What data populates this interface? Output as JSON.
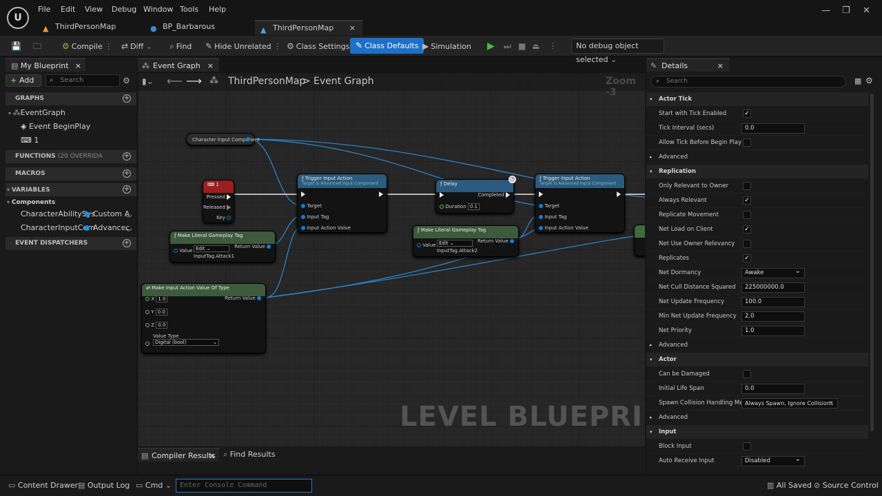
{
  "menu": [
    "File",
    "Edit",
    "View",
    "Debug",
    "Window",
    "Tools",
    "Help"
  ],
  "tabs": [
    {
      "label": "ThirdPersonMap"
    },
    {
      "label": "BP_Barbarous"
    },
    {
      "label": "ThirdPersonMap"
    }
  ],
  "tab_close": "×",
  "toolbar": {
    "compile": "Compile",
    "diff": "Diff",
    "find": "Find",
    "hide_unrelated": "Hide Unrelated",
    "class_settings": "Class Settings",
    "class_defaults": "Class Defaults",
    "simulation": "Simulation",
    "debug_object": "No debug object selected"
  },
  "my_blueprint": {
    "title": "My Blueprint",
    "add": "Add",
    "search_placeholder": "Search",
    "graphs": "GRAPHS",
    "event_graph": "EventGraph",
    "begin_play": "Event BeginPlay",
    "item_1": "1",
    "functions": "FUNCTIONS",
    "functions_count": "(20 OVERRIDA",
    "macros": "MACROS",
    "variables": "VARIABLES",
    "components": "Components",
    "comp1_name": "CharacterAbilitySys",
    "comp1_type": "Custom A",
    "comp2_name": "CharacterInputCom",
    "comp2_type": "Advancec",
    "event_dispatchers": "EVENT DISPATCHERS"
  },
  "graph": {
    "tab": "Event Graph",
    "crumb_root": "ThirdPersonMap",
    "crumb_sep": ">",
    "crumb_leaf": "Event Graph",
    "zoom": "Zoom -3",
    "watermark": "LEVEL BLUEPRINT",
    "nodes": {
      "char_input": "Character Input Component",
      "key_title": "1",
      "pressed": "Pressed",
      "released": "Released",
      "key": "Key",
      "trigger_title": "Trigger Input Action",
      "trigger_sub": "Target is Advanced Input Component",
      "target": "Target",
      "input_tag": "Input Tag",
      "input_action_value": "Input Action Value",
      "delay_title": "Delay",
      "completed": "Completed",
      "duration": "Duration",
      "duration_val": "0.1",
      "tag1_title": "Make Literal Gameplay Tag",
      "value": "Value",
      "edit": "Edit",
      "return_value": "Return Value",
      "tag1_val": "InputTag.Attack1",
      "tag2_val": "InputTag.Attack2",
      "miav_title": "Make Input Action Value Of Type",
      "x": "X",
      "y": "Y",
      "z": "Z",
      "x_val": "1.0",
      "y_val": "0.0",
      "z_val": "0.0",
      "value_type": "Value Type",
      "value_type_val": "Digital (bool)"
    }
  },
  "bottom_tabs": {
    "compiler_results": "Compiler Results",
    "find_results": "Find Results"
  },
  "details": {
    "title": "Details",
    "search_placeholder": "Search",
    "actor_tick": "Actor Tick",
    "start_tick": "Start with Tick Enabled",
    "tick_interval": "Tick Interval (secs)",
    "tick_interval_val": "0.0",
    "allow_tick": "Allow Tick Before Begin Play",
    "advanced": "Advanced",
    "replication": "Replication",
    "only_relevant": "Only Relevant to Owner",
    "always_relevant": "Always Relevant",
    "replicate_movement": "Replicate Movement",
    "net_load": "Net Load on Client",
    "net_use_owner": "Net Use Owner Relevancy",
    "replicates": "Replicates",
    "net_dormancy": "Net Dormancy",
    "net_dormancy_val": "Awake",
    "net_cull": "Net Cull Distance Squared",
    "net_cull_val": "225000000.0",
    "net_update": "Net Update Frequency",
    "net_update_val": "100.0",
    "min_net_update": "Min Net Update Frequency",
    "min_net_update_val": "2.0",
    "net_priority": "Net Priority",
    "net_priority_val": "1.0",
    "actor": "Actor",
    "can_be_damaged": "Can be Damaged",
    "life_span": "Initial Life Span",
    "life_span_val": "0.0",
    "spawn_coll": "Spawn Collision Handling Me...",
    "spawn_coll_val": "Always Spawn, Ignore Collisions",
    "input": "Input",
    "block_input": "Block Input",
    "auto_receive": "Auto Receive Input",
    "auto_receive_val": "Disabled"
  },
  "bottombar": {
    "content_drawer": "Content Drawer",
    "output_log": "Output Log",
    "cmd": "Cmd",
    "console_placeholder": "Enter Console Command",
    "all_saved": "All Saved",
    "source_control": "Source Control"
  }
}
